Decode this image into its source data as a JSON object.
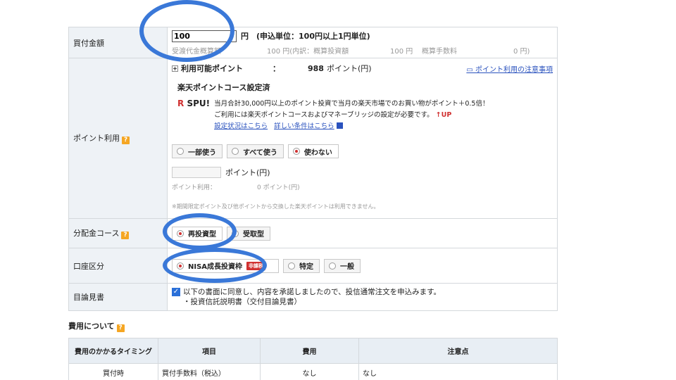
{
  "amount": {
    "label": "買付金額",
    "input_value": "100",
    "unit_and_note": "円　(申込単位：100円以上1円単位)",
    "estimate_label": "受渡代金概算額",
    "estimate_value": "100 円(内訳：概算投資額",
    "invest_value": "100 円",
    "fee_label": "概算手数料",
    "fee_value": "0 円)"
  },
  "points": {
    "label": "ポイント利用",
    "available_label": "利用可能ポイント",
    "available_sep": "：",
    "available_value": "988",
    "available_unit": "ポイント(円)",
    "notice_link": "ポイント利用の注意事項",
    "course_status": "楽天ポイントコース設定済",
    "spu_logo_r": "R",
    "spu_logo_text": "SPU!",
    "spu_text1": "当月合計30,000円以上のポイント投資で当月の楽天市場でのお買い物がポイント＋0.5倍！",
    "spu_text2": "ご利用には楽天ポイントコースおよびマネーブリッジの設定が必要です。",
    "up_badge": "↑UP",
    "settings_link": "設定状況はこちら",
    "detail_link": "詳しい条件はこちら",
    "options": [
      "一部使う",
      "すべて使う",
      "使わない"
    ],
    "selected_index": 2,
    "input_unit": "ポイント(円)",
    "use_label": "ポイント利用：",
    "use_value": "0 ポイント(円)",
    "footnote": "※期間限定ポイント及び他ポイントから交換した楽天ポイントは利用できません。"
  },
  "distribution": {
    "label": "分配金コース",
    "options": [
      "再投資型",
      "受取型"
    ],
    "selected_index": 0
  },
  "account": {
    "label": "口座区分",
    "nisa_label": "NISA成長投資枠",
    "nisa_badge": "非課税",
    "others": [
      "特定",
      "一般"
    ]
  },
  "prospectus": {
    "label": "目論見書",
    "agree_text": "以下の書面に同意し、内容を承諾しましたので、投信通常注文を申込みます。",
    "doc_text": "・投資信託説明書（交付目論見書）"
  },
  "costs": {
    "title": "費用について",
    "headers": [
      "費用のかかるタイミング",
      "項目",
      "費用",
      "注意点"
    ],
    "rows": [
      [
        "買付時",
        "買付手数料（税込）",
        "なし",
        "なし"
      ]
    ]
  },
  "help_glyph": "?",
  "colors": {
    "accent": "#3a78d8",
    "label_bg": "#eef2f6",
    "selected": "#d03030",
    "link": "#2a52be"
  }
}
